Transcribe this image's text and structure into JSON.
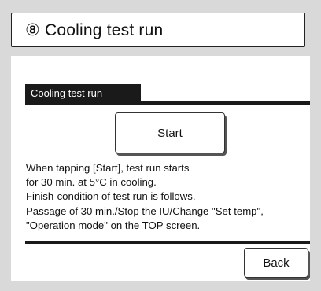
{
  "header": {
    "title": "⑧ Cooling test run"
  },
  "section": {
    "label": "Cooling test run"
  },
  "buttons": {
    "start_label": "Start",
    "back_label": "Back"
  },
  "description": {
    "lines": [
      "When tapping [Start], test run starts",
      "for 30 min. at 5°C in cooling.",
      "Finish-condition of test run is follows.",
      "Passage of 30 min./Stop the IU/Change \"Set temp\",",
      "\"Operation mode\" on the TOP screen."
    ]
  }
}
